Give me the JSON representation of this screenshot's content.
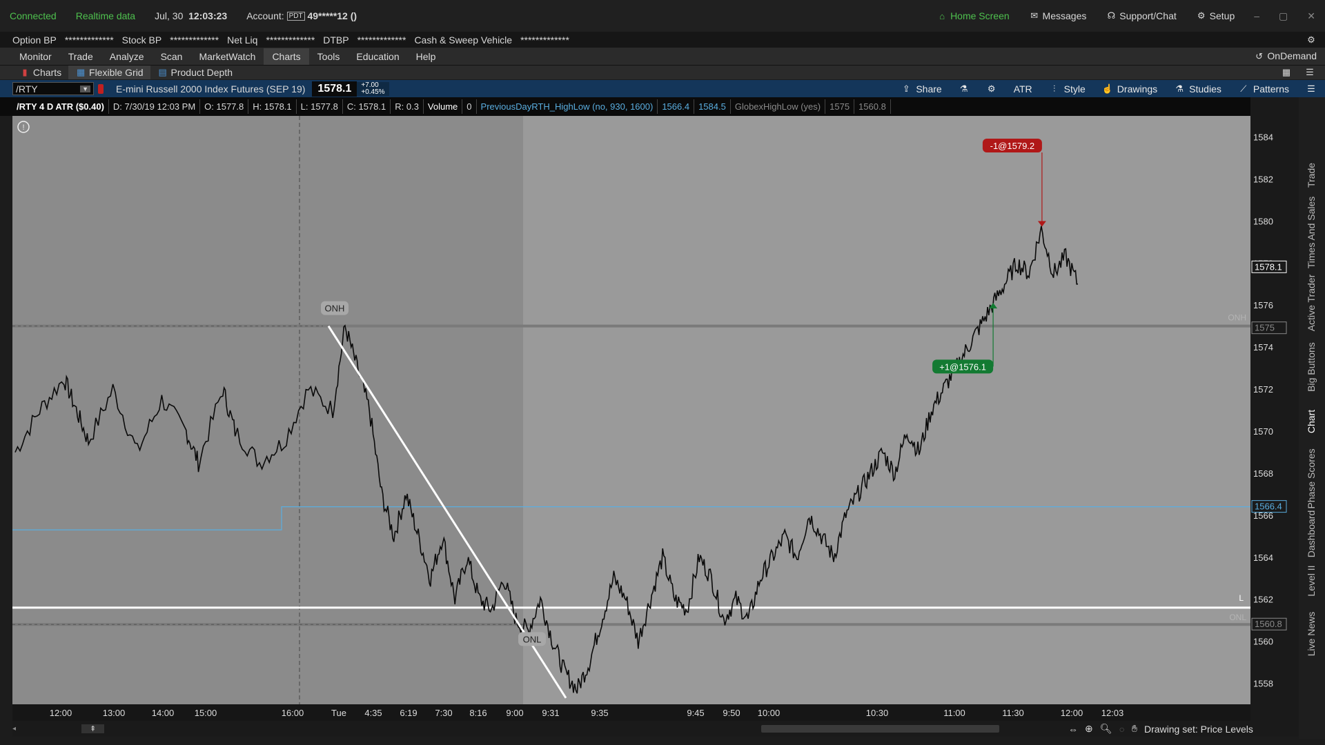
{
  "status": {
    "connected": "Connected",
    "realtime": "Realtime data",
    "date": "Jul, 30",
    "time": "12:03:23",
    "account_label": "Account:",
    "account_badge": "PDT",
    "account_value": "49*****12 ()",
    "home": "Home Screen",
    "messages": "Messages",
    "support": "Support/Chat",
    "setup": "Setup"
  },
  "account": [
    {
      "label": "Option BP",
      "value": "*************"
    },
    {
      "label": "Stock BP",
      "value": "*************"
    },
    {
      "label": "Net Liq",
      "value": "*************"
    },
    {
      "label": "DTBP",
      "value": "*************"
    },
    {
      "label": "Cash & Sweep Vehicle",
      "value": "*************"
    }
  ],
  "menu": [
    "Monitor",
    "Trade",
    "Analyze",
    "Scan",
    "MarketWatch",
    "Charts",
    "Tools",
    "Education",
    "Help"
  ],
  "menu_active": "Charts",
  "ondemand": "OnDemand",
  "subtabs": [
    "Charts",
    "Flexible Grid",
    "Product Depth"
  ],
  "symbol": {
    "ticker": "/RTY",
    "description": "E-mini Russell 2000 Index Futures (SEP 19)",
    "price": "1578.1",
    "change": "+7.00",
    "change_pct": "+0.45%"
  },
  "toolbar": {
    "share": "Share",
    "atr": "ATR",
    "style": "Style",
    "drawings": "Drawings",
    "studies": "Studies",
    "patterns": "Patterns"
  },
  "info": {
    "title": "/RTY 4 D ATR ($0.40)",
    "d": "D: 7/30/19 12:03 PM",
    "o": "O: 1577.8",
    "h": "H: 1578.1",
    "l": "L: 1577.8",
    "c": "C: 1578.1",
    "r": "R: 0.3",
    "volume": "Volume",
    "volume_val": "0",
    "study1": "PreviousDayRTH_HighLow (no, 930, 1600)",
    "study1_v1": "1566.4",
    "study1_v2": "1584.5",
    "study2": "GlobexHighLow (yes)",
    "study2_v1": "1575",
    "study2_v2": "1560.8"
  },
  "right_tabs": [
    "Trade",
    "Times And Sales",
    "Active Trader",
    "Big Buttons",
    "Chart",
    "Phase Scores",
    "Dashboard",
    "Level II",
    "Live News"
  ],
  "drawing_set": "Drawing set: Price Levels",
  "chart_data": {
    "type": "line",
    "ylim": [
      1557,
      1585
    ],
    "yticks": [
      "1584",
      "1582",
      "1580",
      "1578",
      "1576",
      "1574",
      "1572",
      "1570",
      "1568",
      "1566",
      "1564",
      "1562",
      "1560",
      "1558"
    ],
    "xticks": [
      "12:00",
      "13:00",
      "14:00",
      "15:00",
      "16:00",
      "Tue",
      "4:35",
      "6:19",
      "7:30",
      "8:16",
      "9:00",
      "9:31",
      "9:35",
      "9:45",
      "9:50",
      "10:00",
      "10:30",
      "11:00",
      "11:30",
      "12:00",
      "12:03"
    ],
    "price_labels": [
      {
        "text": "1578.1",
        "y": 1577.8,
        "color": "#ffffff"
      },
      {
        "text": "1575",
        "y": 1574.9,
        "color": "#8a8a8a"
      },
      {
        "text": "1566.4",
        "y": 1566.4,
        "color": "#5aaee0"
      },
      {
        "text": "1560.8",
        "y": 1560.8,
        "color": "#8a8a8a"
      }
    ],
    "series_points": [
      [
        0,
        1569
      ],
      [
        2,
        1571
      ],
      [
        4,
        1572.5
      ],
      [
        5,
        1571
      ],
      [
        6,
        1569.5
      ],
      [
        8,
        1572
      ],
      [
        10,
        1569
      ],
      [
        12,
        1571.5
      ],
      [
        14,
        1570
      ],
      [
        15,
        1568.5
      ],
      [
        17,
        1572
      ],
      [
        18,
        1570
      ],
      [
        20,
        1568.5
      ],
      [
        22,
        1569.5
      ],
      [
        24,
        1572
      ],
      [
        26,
        1571
      ],
      [
        27,
        1575
      ],
      [
        28,
        1573
      ],
      [
        29,
        1571
      ],
      [
        30,
        1567
      ],
      [
        31,
        1565
      ],
      [
        32,
        1567
      ],
      [
        33,
        1565
      ],
      [
        34,
        1563
      ],
      [
        35,
        1565
      ],
      [
        36,
        1562
      ],
      [
        37,
        1564
      ],
      [
        38,
        1562
      ],
      [
        39,
        1561.5
      ],
      [
        40,
        1563
      ],
      [
        41,
        1561
      ],
      [
        42,
        1560.5
      ],
      [
        43,
        1562
      ],
      [
        44,
        1560
      ],
      [
        45,
        1558.5
      ],
      [
        46,
        1557.7
      ],
      [
        47,
        1559
      ],
      [
        48,
        1561
      ],
      [
        49,
        1563
      ],
      [
        50,
        1562
      ],
      [
        51,
        1560
      ],
      [
        52,
        1562
      ],
      [
        53,
        1564
      ],
      [
        54,
        1562
      ],
      [
        55,
        1561.5
      ],
      [
        56,
        1564
      ],
      [
        57,
        1563
      ],
      [
        58,
        1561
      ],
      [
        59,
        1562
      ],
      [
        60,
        1561
      ],
      [
        61,
        1563
      ],
      [
        62,
        1564
      ],
      [
        63,
        1565
      ],
      [
        64,
        1564
      ],
      [
        65,
        1566
      ],
      [
        66,
        1565
      ],
      [
        67,
        1564
      ],
      [
        68,
        1566
      ],
      [
        69,
        1567
      ],
      [
        70,
        1568
      ],
      [
        71,
        1569
      ],
      [
        72,
        1568
      ],
      [
        73,
        1570
      ],
      [
        74,
        1569
      ],
      [
        75,
        1571
      ],
      [
        76,
        1572
      ],
      [
        77,
        1573
      ],
      [
        78,
        1574
      ],
      [
        79,
        1575
      ],
      [
        80,
        1576
      ],
      [
        81,
        1577
      ],
      [
        82,
        1578
      ],
      [
        83,
        1577.5
      ],
      [
        84,
        1579.6
      ],
      [
        85,
        1577.5
      ],
      [
        86,
        1578.3
      ],
      [
        87,
        1577
      ]
    ],
    "annotations": {
      "sell": "-1@1579.2",
      "buy": "+1@1576.1",
      "onh": "ONH",
      "onl": "ONL",
      "onh_right": "ONH",
      "onl_right": "ONL",
      "l_mark": "L"
    },
    "levels": {
      "onh": 1575,
      "onl": 1560.8,
      "prev_rth_low": 1566.4,
      "prev_rth_low_before": 1565.3,
      "support": 1561.6
    },
    "colors": {
      "background": "#9a9a9a",
      "shade": "#8c8c8c",
      "line": "#0a0a0a",
      "sell": "#b01818",
      "buy": "#137a32",
      "cyan": "#5aaee0"
    }
  }
}
